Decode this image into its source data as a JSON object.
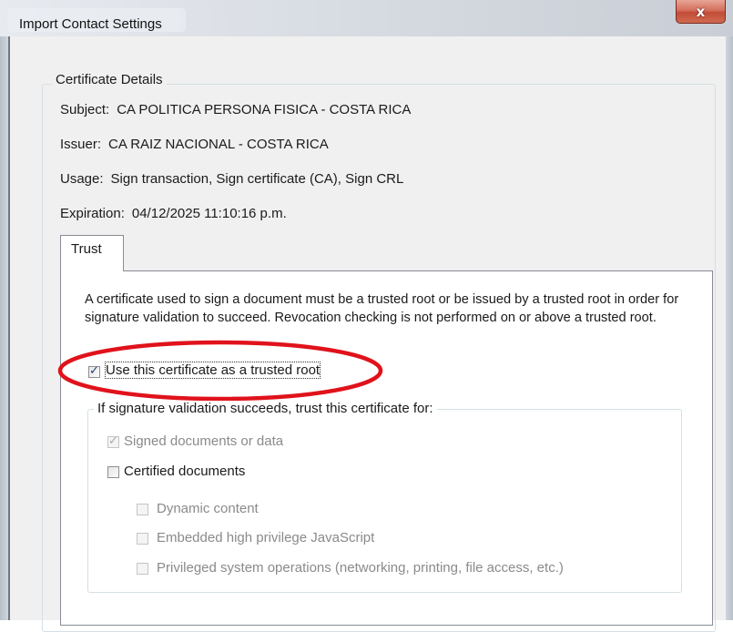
{
  "window": {
    "title": "Import Contact Settings",
    "close_glyph": "x",
    "accent_colors": {
      "close_button": "#c24d38",
      "annotation": "#e0121b"
    }
  },
  "certificate_details": {
    "group_label": "Certificate Details",
    "subject_label": "Subject:",
    "subject_value": "CA POLITICA PERSONA FISICA - COSTA RICA",
    "issuer_label": "Issuer:",
    "issuer_value": "CA RAIZ NACIONAL - COSTA RICA",
    "usage_label": "Usage:",
    "usage_value": "Sign transaction, Sign certificate (CA), Sign CRL",
    "expiration_label": "Expiration:",
    "expiration_value": "04/12/2025 11:10:16 p.m."
  },
  "tabs": [
    {
      "label": "Trust",
      "selected": true
    }
  ],
  "trust": {
    "description": "A certificate used to sign a document must be a trusted root or be issued by a trusted root in order for signature validation to succeed.  Revocation checking is not performed on or above a trusted root.",
    "trusted_root": {
      "label": "Use this certificate as a trusted root",
      "checked": true
    },
    "trust_group_label": "If signature validation succeeds, trust this certificate for:",
    "options": {
      "signed_documents": {
        "label": "Signed documents or data",
        "checked": true,
        "enabled": false
      },
      "certified_documents": {
        "label": "Certified documents",
        "checked": false,
        "enabled": true
      },
      "dynamic_content": {
        "label": "Dynamic content",
        "checked": false,
        "enabled": false
      },
      "embedded_javascript": {
        "label": "Embedded high privilege JavaScript",
        "checked": false,
        "enabled": false
      },
      "privileged_operations": {
        "label": "Privileged system operations (networking, printing, file access, etc.)",
        "checked": false,
        "enabled": false
      }
    }
  }
}
